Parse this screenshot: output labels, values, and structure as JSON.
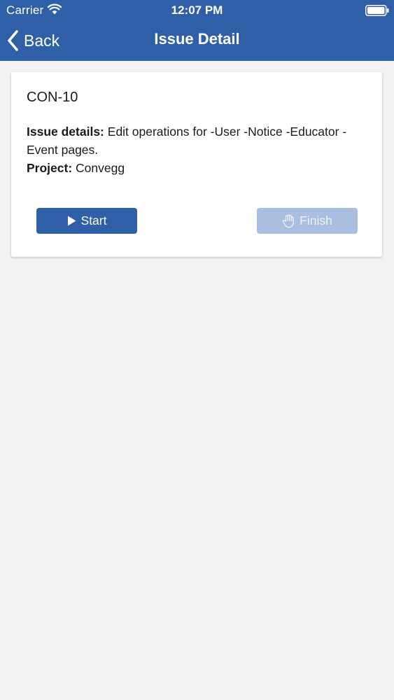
{
  "status_bar": {
    "carrier": "Carrier",
    "time": "12:07 PM"
  },
  "nav": {
    "back_label": "Back",
    "title": "Issue Detail"
  },
  "issue": {
    "key": "CON-10",
    "details_label": "Issue details:",
    "details_value": "Edit operations for -User -Notice -Educator -Event  pages.",
    "project_label": "Project:",
    "project_value": "Convegg"
  },
  "actions": {
    "start_label": "Start",
    "finish_label": "Finish",
    "start_icon": "play-icon",
    "finish_icon": "hand-icon"
  },
  "colors": {
    "header": "#2f5fa6",
    "start_button": "#2f5fa6",
    "finish_button_disabled": "#a9bfdf",
    "background": "#f2f2f3"
  }
}
